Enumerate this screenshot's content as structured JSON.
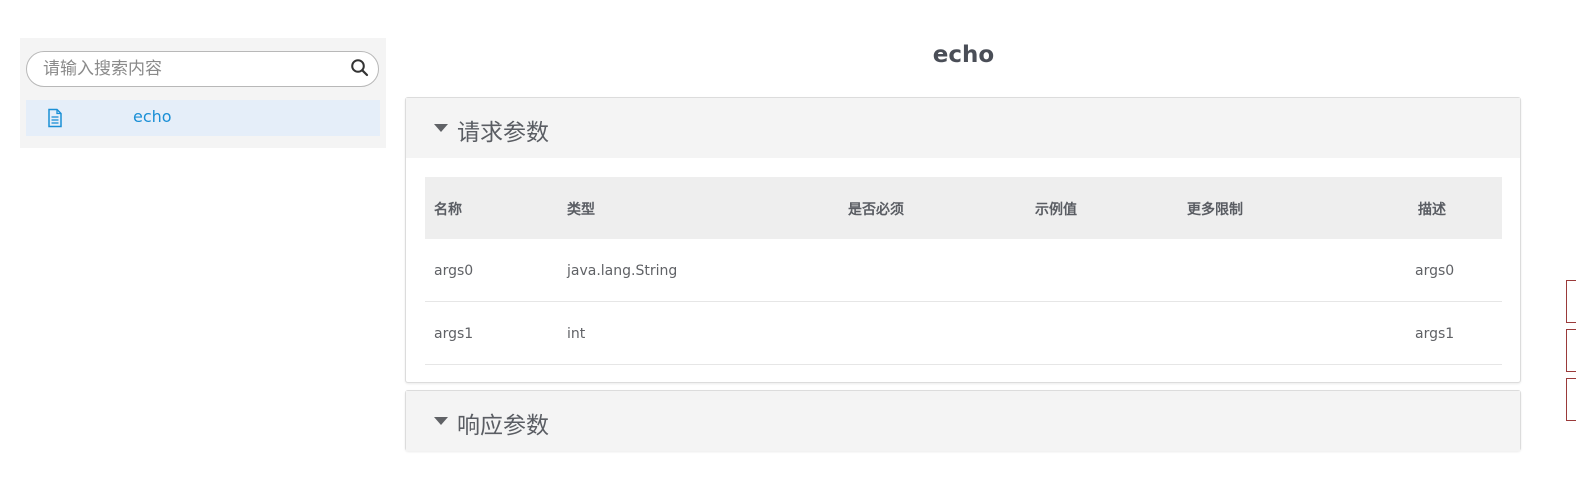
{
  "sidebar": {
    "search": {
      "placeholder": "请输入搜索内容",
      "value": ""
    },
    "items": [
      {
        "label": "echo",
        "icon": "document-icon",
        "active": true
      }
    ]
  },
  "main": {
    "title": "echo",
    "request_panel": {
      "title": "请求参数",
      "expanded": true,
      "columns": [
        "名称",
        "类型",
        "是否必须",
        "示例值",
        "更多限制",
        "描述"
      ],
      "rows": [
        [
          "args0",
          "java.lang.String",
          "",
          "",
          "",
          "args0"
        ],
        [
          "args1",
          "int",
          "",
          "",
          "",
          "args1"
        ]
      ]
    },
    "response_panel": {
      "title": "响应参数",
      "expanded": true
    }
  },
  "colors": {
    "accent": "#1a8fd6",
    "active_bg": "#e5eef9",
    "panel_header_bg": "#f4f4f4",
    "table_header_bg": "#eeeeee"
  }
}
